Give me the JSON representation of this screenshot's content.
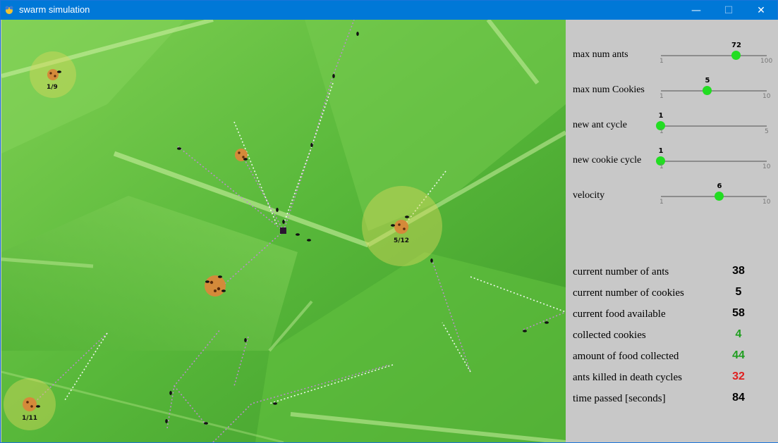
{
  "window": {
    "title": "swarm simulation",
    "minimize_glyph": "—",
    "maximize_glyph": "☐",
    "close_glyph": "✕"
  },
  "sliders": [
    {
      "label": "max num ants",
      "value": "72",
      "min": "1",
      "max": "100"
    },
    {
      "label": "max num Cookies",
      "value": "5",
      "min": "1",
      "max": "10"
    },
    {
      "label": "new ant cycle",
      "value": "1",
      "min": "1",
      "max": "5"
    },
    {
      "label": "new cookie cycle",
      "value": "1",
      "min": "1",
      "max": "10"
    },
    {
      "label": "velocity",
      "value": "6",
      "min": "1",
      "max": "10"
    }
  ],
  "stats": [
    {
      "label": "current number of ants",
      "value": "38",
      "color": "#000000"
    },
    {
      "label": "current number of cookies",
      "value": "5",
      "color": "#000000"
    },
    {
      "label": "current food available",
      "value": "58",
      "color": "#000000"
    },
    {
      "label": "collected cookies",
      "value": "4",
      "color": "#1f9e1f"
    },
    {
      "label": "amount of food collected",
      "value": "44",
      "color": "#1f9e1f"
    },
    {
      "label": "ants killed in death cycles",
      "value": "32",
      "color": "#e02020"
    },
    {
      "label": "time passed [seconds]",
      "value": "84",
      "color": "#000000"
    }
  ],
  "cookies": [
    {
      "label": "1/9"
    },
    {
      "label": "5/12"
    },
    {
      "label": "1/11"
    }
  ],
  "colors": {
    "titlebar": "#0078d7",
    "knob": "#22dd22",
    "panel": "#c8c8c8",
    "leaf": "#5cbd3c"
  }
}
